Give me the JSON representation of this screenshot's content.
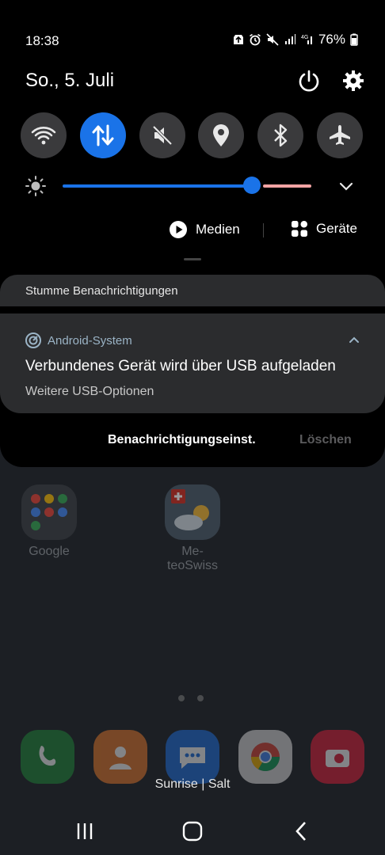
{
  "status_bar": {
    "time": "18:38",
    "battery": "76%",
    "icons": [
      "upload-icon",
      "alarm-icon",
      "mute-icon",
      "signal-icon",
      "signal-4g-icon",
      "battery-icon"
    ]
  },
  "header": {
    "date": "So., 5. Juli"
  },
  "quick_settings": {
    "toggles": [
      {
        "name": "wifi",
        "icon": "wifi-icon",
        "active": false
      },
      {
        "name": "mobile-data",
        "icon": "data-transfer-icon",
        "active": true
      },
      {
        "name": "sound",
        "icon": "sound-off-icon",
        "active": false
      },
      {
        "name": "location",
        "icon": "location-icon",
        "active": false
      },
      {
        "name": "bluetooth",
        "icon": "bluetooth-icon",
        "active": false
      },
      {
        "name": "airplane",
        "icon": "airplane-icon",
        "active": false
      }
    ],
    "brightness_level": 0.76,
    "accent_color": "#1a73e8"
  },
  "media_row": {
    "media_label": "Medien",
    "devices_label": "Geräte"
  },
  "notifications": {
    "section_title": "Stumme Benachrichtigungen",
    "items": [
      {
        "app": "Android-System",
        "title": "Verbundenes Gerät wird über USB aufgeladen",
        "subtitle": "Weitere USB-Optionen"
      }
    ],
    "settings_label": "Benachrichtigungseinst.",
    "clear_label": "Löschen"
  },
  "home": {
    "folder_label": "Google",
    "app_label_line1": "Me-",
    "app_label_line2": "teoSwiss",
    "carrier": "Sunrise | Salt"
  }
}
